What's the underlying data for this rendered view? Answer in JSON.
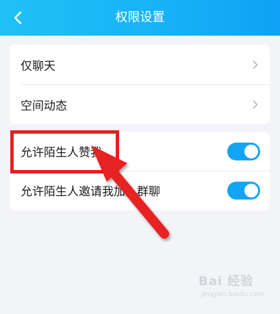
{
  "header": {
    "title": "权限设置",
    "back_icon": "back-arrow-icon"
  },
  "settings_group_1": {
    "items": [
      {
        "label": "仅聊天",
        "icon": "chevron-right-icon"
      },
      {
        "label": "空间动态",
        "icon": "chevron-right-icon"
      }
    ]
  },
  "settings_group_2": {
    "items": [
      {
        "label": "允许陌生人赞我",
        "toggle": "on"
      },
      {
        "label": "允许陌生人邀请我加入群聊",
        "toggle": "on"
      }
    ]
  },
  "annotation": {
    "box_color": "#e62020",
    "arrow_color": "#e62020"
  },
  "watermark": {
    "logo": "Bai 经验",
    "url": "jingyan.baidu.com"
  },
  "colors": {
    "header_start": "#1fc1f6",
    "header_end": "#0fa2f5",
    "toggle_on": "#12a4f5",
    "background": "#f3f4f8"
  }
}
